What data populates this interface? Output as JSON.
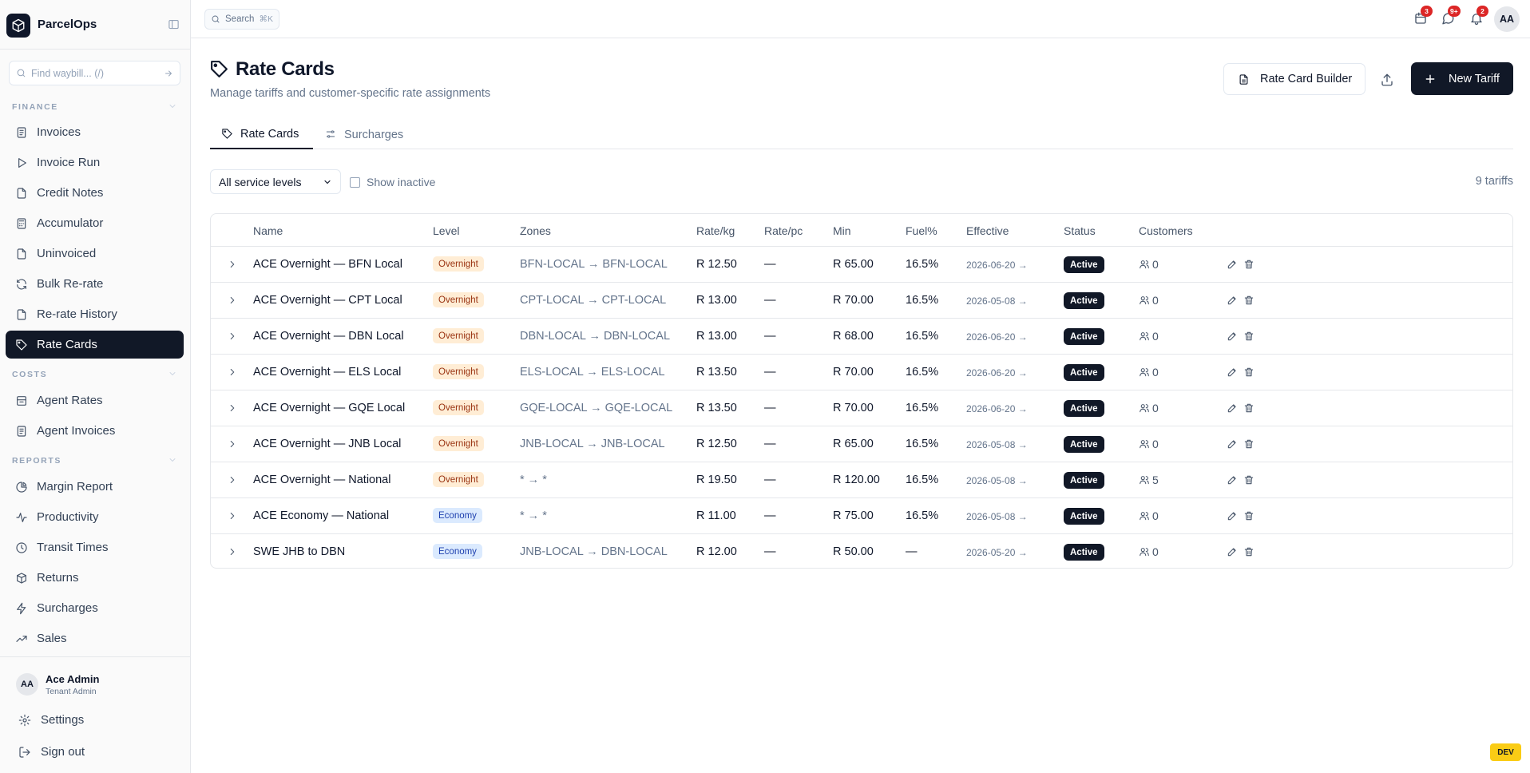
{
  "app": {
    "name": "ParcelOps"
  },
  "sidebar": {
    "find_placeholder": "Find waybill... (/)",
    "sections": {
      "finance": "FINANCE",
      "costs": "COSTS",
      "reports": "REPORTS"
    },
    "finance_items": [
      {
        "label": "Invoices",
        "icon": "invoice-icon"
      },
      {
        "label": "Invoice Run",
        "icon": "play-icon"
      },
      {
        "label": "Credit Notes",
        "icon": "file-icon"
      },
      {
        "label": "Accumulator",
        "icon": "calculator-icon"
      },
      {
        "label": "Uninvoiced",
        "icon": "file-icon"
      },
      {
        "label": "Bulk Re-rate",
        "icon": "refresh-icon"
      },
      {
        "label": "Re-rate History",
        "icon": "file-icon"
      },
      {
        "label": "Rate Cards",
        "icon": "tag-icon",
        "active": true
      }
    ],
    "costs_items": [
      {
        "label": "Agent Rates",
        "icon": "archive-icon"
      },
      {
        "label": "Agent Invoices",
        "icon": "invoice-icon"
      }
    ],
    "reports_items": [
      {
        "label": "Margin Report",
        "icon": "pie-chart-icon"
      },
      {
        "label": "Productivity",
        "icon": "activity-icon"
      },
      {
        "label": "Transit Times",
        "icon": "clock-icon"
      },
      {
        "label": "Returns",
        "icon": "package-icon"
      },
      {
        "label": "Surcharges",
        "icon": "zap-icon"
      },
      {
        "label": "Sales",
        "icon": "trend-up-icon"
      }
    ],
    "user": {
      "initials": "AA",
      "name": "Ace Admin",
      "role": "Tenant Admin"
    },
    "footer": {
      "settings": "Settings",
      "sign_out": "Sign out"
    }
  },
  "topbar": {
    "search_label": "Search",
    "search_shortcut": "⌘K",
    "badges": {
      "tasks": "3",
      "messages": "9+",
      "notifications": "2"
    },
    "avatar": "AA"
  },
  "page": {
    "title": "Rate Cards",
    "subtitle": "Manage tariffs and customer-specific rate assignments",
    "builder_button": "Rate Card Builder",
    "new_button": "New Tariff",
    "tabs": [
      "Rate Cards",
      "Surcharges"
    ],
    "filter_value": "All service levels",
    "show_inactive": "Show inactive",
    "count": "9 tariffs"
  },
  "table": {
    "columns": [
      "Name",
      "Level",
      "Zones",
      "Rate/kg",
      "Rate/pc",
      "Min",
      "Fuel%",
      "Effective",
      "Status",
      "Customers"
    ],
    "rows": [
      {
        "name": "ACE Overnight — BFN Local",
        "level": "Overnight",
        "zones": "BFN-LOCAL → BFN-LOCAL",
        "rate_kg": "R 12.50",
        "rate_pc": "—",
        "min": "R 65.00",
        "fuel": "16.5%",
        "effective": "2026-06-20 →",
        "status": "Active",
        "customers": "0"
      },
      {
        "name": "ACE Overnight — CPT Local",
        "level": "Overnight",
        "zones": "CPT-LOCAL → CPT-LOCAL",
        "rate_kg": "R 13.00",
        "rate_pc": "—",
        "min": "R 70.00",
        "fuel": "16.5%",
        "effective": "2026-05-08 →",
        "status": "Active",
        "customers": "0"
      },
      {
        "name": "ACE Overnight — DBN Local",
        "level": "Overnight",
        "zones": "DBN-LOCAL → DBN-LOCAL",
        "rate_kg": "R 13.00",
        "rate_pc": "—",
        "min": "R 68.00",
        "fuel": "16.5%",
        "effective": "2026-06-20 →",
        "status": "Active",
        "customers": "0"
      },
      {
        "name": "ACE Overnight — ELS Local",
        "level": "Overnight",
        "zones": "ELS-LOCAL → ELS-LOCAL",
        "rate_kg": "R 13.50",
        "rate_pc": "—",
        "min": "R 70.00",
        "fuel": "16.5%",
        "effective": "2026-06-20 →",
        "status": "Active",
        "customers": "0"
      },
      {
        "name": "ACE Overnight — GQE Local",
        "level": "Overnight",
        "zones": "GQE-LOCAL → GQE-LOCAL",
        "rate_kg": "R 13.50",
        "rate_pc": "—",
        "min": "R 70.00",
        "fuel": "16.5%",
        "effective": "2026-06-20 →",
        "status": "Active",
        "customers": "0"
      },
      {
        "name": "ACE Overnight — JNB Local",
        "level": "Overnight",
        "zones": "JNB-LOCAL → JNB-LOCAL",
        "rate_kg": "R 12.50",
        "rate_pc": "—",
        "min": "R 65.00",
        "fuel": "16.5%",
        "effective": "2026-05-08 →",
        "status": "Active",
        "customers": "0"
      },
      {
        "name": "ACE Overnight — National",
        "level": "Overnight",
        "zones": "* → *",
        "rate_kg": "R 19.50",
        "rate_pc": "—",
        "min": "R 120.00",
        "fuel": "16.5%",
        "effective": "2026-05-08 →",
        "status": "Active",
        "customers": "5"
      },
      {
        "name": "ACE Economy — National",
        "level": "Economy",
        "zones": "* → *",
        "rate_kg": "R 11.00",
        "rate_pc": "—",
        "min": "R 75.00",
        "fuel": "16.5%",
        "effective": "2026-05-08 →",
        "status": "Active",
        "customers": "0"
      },
      {
        "name": "SWE JHB to DBN",
        "level": "Economy",
        "zones": "JNB-LOCAL → DBN-LOCAL",
        "rate_kg": "R 12.00",
        "rate_pc": "—",
        "min": "R 50.00",
        "fuel": "—",
        "effective": "2026-05-20 →",
        "status": "Active",
        "customers": "0"
      }
    ]
  },
  "env_badge": "DEV",
  "colors": {
    "primary": "#111827",
    "overnight_bg": "#ffedd5",
    "economy_bg": "#dbeafe",
    "badge_red": "#dc2626",
    "dev_yellow": "#facc15"
  }
}
